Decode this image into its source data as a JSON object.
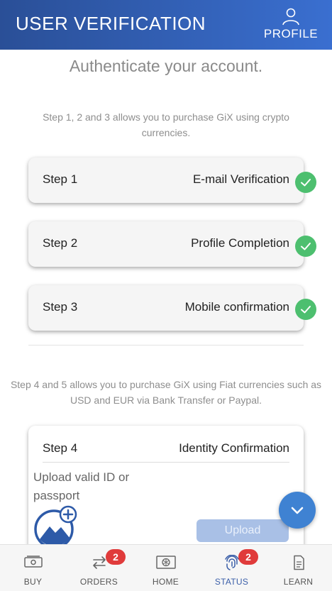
{
  "header": {
    "title": "USER VERIFICATION",
    "profile_label": "PROFILE"
  },
  "subtitle": "Authenticate your account.",
  "info_crypto": "Step 1, 2 and 3 allows you to purchase GiX using crypto currencies.",
  "steps": [
    {
      "label": "Step 1",
      "value": "E-mail Verification",
      "status": "verified"
    },
    {
      "label": "Step 2",
      "value": "Profile Completion",
      "status": "verified"
    },
    {
      "label": "Step 3",
      "value": "Mobile confirmation",
      "status": "verified"
    }
  ],
  "info_fiat": "Step 4 and 5 allows you to purchase GiX using Fiat currencies such as USD and EUR via Bank Transfer or Paypal.",
  "step4": {
    "label": "Step 4",
    "value": "Identity Confirmation",
    "upload_text": "Upload valid ID or passport",
    "upload_button": "Upload"
  },
  "nav": {
    "items": [
      {
        "label": "BUY",
        "icon": "banknote-icon"
      },
      {
        "label": "ORDERS",
        "icon": "swap-arrows-icon",
        "badge": "2"
      },
      {
        "label": "HOME",
        "icon": "home-icon"
      },
      {
        "label": "STATUS",
        "icon": "fingerprint-icon",
        "badge": "2",
        "active": true
      },
      {
        "label": "LEARN",
        "icon": "document-icon"
      }
    ]
  },
  "colors": {
    "header_start": "#2a4f97",
    "header_end": "#3a6fd0",
    "check_green": "#4dbf6f",
    "badge_red": "#e03b3b",
    "fab_blue": "#3f82d2",
    "upload_button": "#a9c0e6",
    "active_nav": "#3a5ea8"
  }
}
